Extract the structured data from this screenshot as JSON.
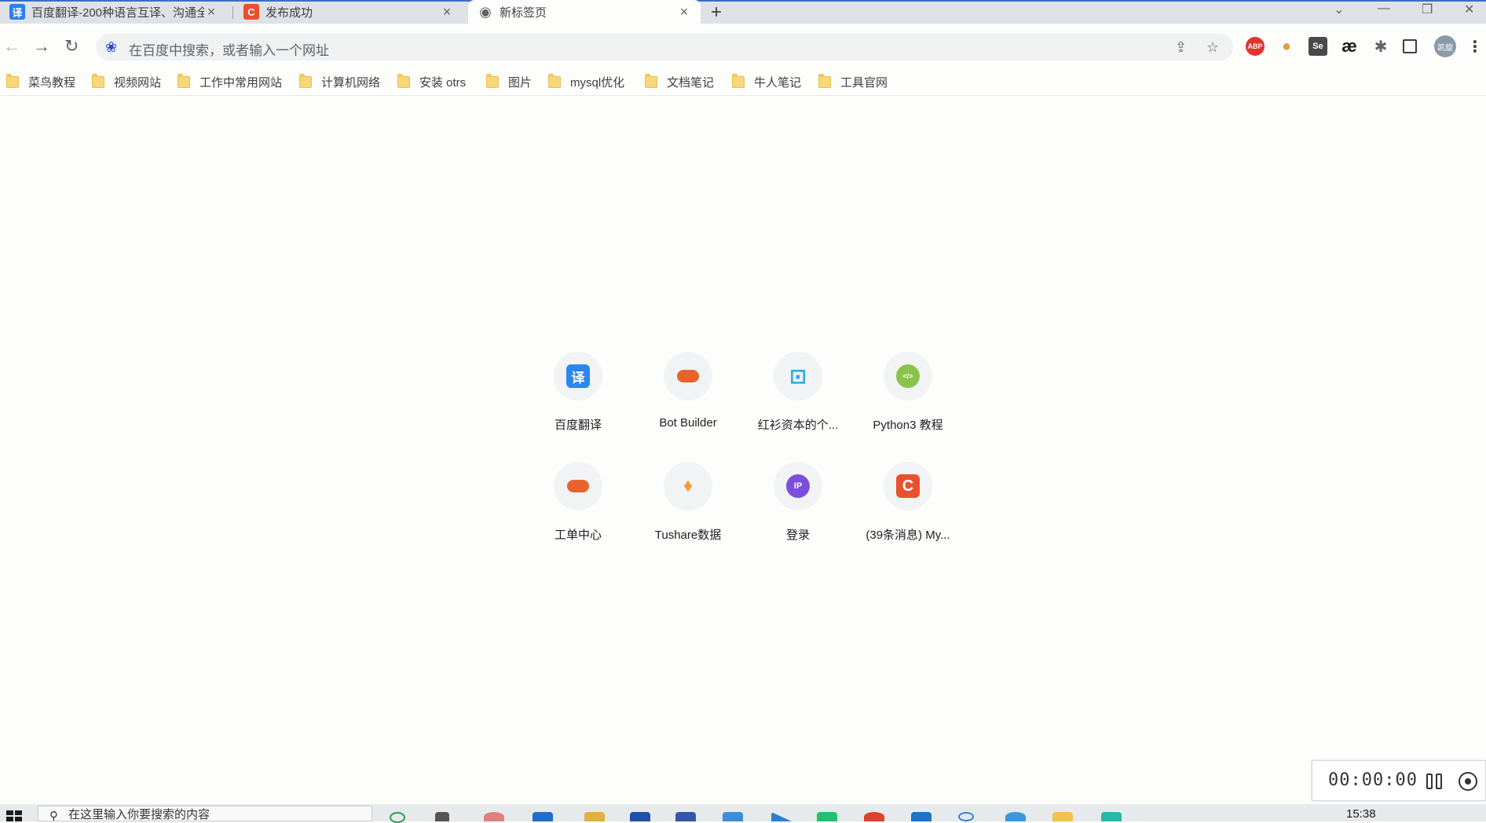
{
  "tabs": [
    {
      "title": "百度翻译-200种语言互译、沟通全",
      "favicon_text": "译",
      "favicon_color": "#2b7ef0",
      "active": false
    },
    {
      "title": "发布成功",
      "favicon_text": "C",
      "favicon_color": "#e8512f",
      "active": false
    },
    {
      "title": "新标签页",
      "favicon_text": "◉",
      "favicon_color": "#5f6368",
      "active": true
    }
  ],
  "omnibox": {
    "placeholder": "在百度中搜索，或者输入一个网址"
  },
  "extensions": [
    {
      "name": "adblock-icon",
      "text": "ABP",
      "color": "#e0342c"
    },
    {
      "name": "cookie-icon",
      "text": "●",
      "color": "#e0a040"
    },
    {
      "name": "selenium-icon",
      "text": "Se",
      "color": "#4a4a4a"
    },
    {
      "name": "ae-icon",
      "text": "æ",
      "color": "#1b1b1b"
    },
    {
      "name": "puzzle-icon",
      "text": "✱",
      "color": "#5f6368"
    },
    {
      "name": "sidepanel-icon",
      "text": "▮",
      "color": "#3c4043"
    }
  ],
  "profile": {
    "text": "凯旋",
    "color": "#8a9ba8"
  },
  "bookmarks": [
    "菜鸟教程",
    "视频网站",
    "工作中常用网站",
    "计算机网络",
    "安装 otrs",
    "图片",
    "mysql优化",
    "文档笔记",
    "牛人笔记",
    "工具官网"
  ],
  "shortcuts": [
    {
      "label": "百度翻译",
      "icon": "translate-icon",
      "glyph": "译",
      "bg": "#2b86f0"
    },
    {
      "label": "Bot Builder",
      "icon": "chat-bubble-icon",
      "glyph": "",
      "bg": "#e8632c"
    },
    {
      "label": "红衫资本的个...",
      "icon": "bilibili-icon",
      "glyph": "⊡",
      "bg": "#23ade5"
    },
    {
      "label": "Python3 教程",
      "icon": "code-icon",
      "glyph": "</>",
      "bg": "#8bc34a"
    },
    {
      "label": "工单中心",
      "icon": "chat-bubble-icon",
      "glyph": "",
      "bg": "#e8632c"
    },
    {
      "label": "Tushare数据",
      "icon": "carrot-icon",
      "glyph": "♦",
      "bg": "#f29b38"
    },
    {
      "label": "登录",
      "icon": "ip-icon",
      "glyph": "IP",
      "bg": "#7a4fdc"
    },
    {
      "label": "(39条消息) My...",
      "icon": "csdn-icon",
      "glyph": "C",
      "bg": "#e8512f"
    }
  ],
  "recorder": {
    "time": "00:00:00"
  },
  "taskbar": {
    "search_placeholder": "在这里输入你要搜索的内容",
    "clock": "15:38"
  }
}
